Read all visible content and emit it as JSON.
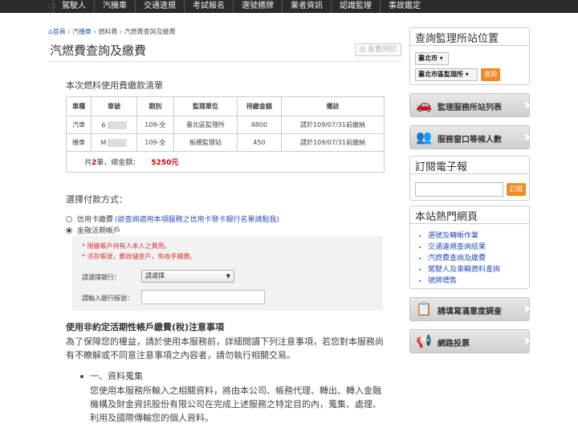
{
  "nav": {
    "items": [
      "駕駛人",
      "汽機車",
      "交通違規",
      "考試報名",
      "選號標牌",
      "業者資訊",
      "認識監理",
      "事故鑑定"
    ]
  },
  "breadcrumb": {
    "home": "首頁",
    "vehicle": "汽機車",
    "fuel": "燃料費",
    "current": "汽燃費查詢及繳費"
  },
  "page": {
    "title": "汽燃費查詢及繳費",
    "print_label": "友善列印"
  },
  "bill": {
    "heading": "本次燃料使用費繳款清單",
    "columns": [
      "車種",
      "車號",
      "期別",
      "監理單位",
      "待繳金額",
      "備註"
    ],
    "rows": [
      {
        "type": "汽車",
        "plate": "6",
        "period": "109-全",
        "office": "臺北區監理所",
        "amount": "4800",
        "note": "請於109/07/31前繳納"
      },
      {
        "type": "機車",
        "plate": "M",
        "period": "109-全",
        "office": "板橋監理站",
        "amount": "450",
        "note": "請於109/07/31前繳納"
      }
    ],
    "total_prefix": "共",
    "total_count": "2",
    "total_mid": "筆，總金額：",
    "total_amount": "5250元"
  },
  "payment": {
    "heading": "選擇付款方式：",
    "option_credit": "信用卡繳費",
    "credit_link": "(欲查詢適用本項服務之信用卡發卡銀行名單請點我)",
    "option_bank": "金融活期帳戶",
    "note1": "* 限繳帳戶持有人本人之費用。",
    "note2": "* 活存帳號，郵政儲金戶，免收手續費。",
    "bank_label": "請選擇銀行：",
    "bank_selected": "請選擇",
    "account_label": "請輸入銀行帳號："
  },
  "terms": {
    "heading": "使用非約定活期性帳戶繳費(稅)注意事項",
    "intro": "為了保障您的權益，請於使用本服務前，詳細閱讀下列注意事項，若您對本服務尚有不瞭解或不同意注意事項之內容者，請勿執行相關交易。",
    "item1_title": "一、資料蒐集",
    "item1_body": "您使用本服務所輸入之相關資料，將由本公司、帳務代理、轉出、轉入金融機構及財金資訊股份有限公司在完成上述服務之特定目的內，蒐集、處理、利用及國際傳輸您的個人資料。"
  },
  "sidebar": {
    "station_title": "查詢監理所站位置",
    "city": "臺北市",
    "office": "臺北市區監理所",
    "query_label": "查詢",
    "station_list": "監理服務所站列表",
    "queue": "服務窗口等候人數",
    "subscribe_title": "訂閱電子報",
    "subscribe_label": "訂閱",
    "hot_title": "本站熱門網頁",
    "hot_links": [
      "選號及轉帳作業",
      "交通違規查詢結果",
      "汽燃費查詢及繳費",
      "駕駛人及車輛資料查詢",
      "號牌標售"
    ],
    "survey": "請填寫滿意度調查",
    "vote": "網路投票"
  }
}
